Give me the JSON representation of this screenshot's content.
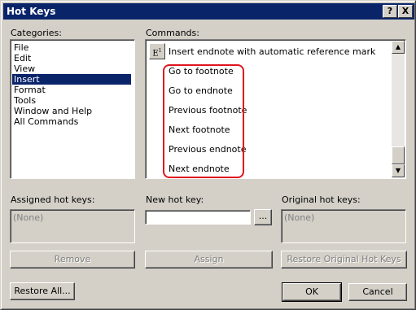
{
  "window": {
    "title": "Hot Keys",
    "help_glyph": "?",
    "close_glyph": "X"
  },
  "categories": {
    "label": "Categories:",
    "items": [
      "File",
      "Edit",
      "View",
      "Insert",
      "Format",
      "Tools",
      "Window and Help",
      "All Commands"
    ],
    "selected": "Insert"
  },
  "commands": {
    "label": "Commands:",
    "first_item": "Insert endnote with automatic reference mark",
    "first_icon_glyph": "E",
    "items": [
      "Go to footnote",
      "Go to endnote",
      "Previous footnote",
      "Next footnote",
      "Previous endnote",
      "Next endnote"
    ]
  },
  "assigned": {
    "label": "Assigned hot keys:",
    "value": "(None)",
    "button": "Remove"
  },
  "newkey": {
    "label": "New hot key:",
    "value": "",
    "browse": "...",
    "button": "Assign"
  },
  "original": {
    "label": "Original hot keys:",
    "value": "(None)",
    "button": "Restore Original Hot Keys"
  },
  "footer": {
    "restore_all": "Restore All...",
    "ok": "OK",
    "cancel": "Cancel"
  },
  "colors": {
    "highlight_box": "#e0141e",
    "selection": "#0a246a"
  }
}
